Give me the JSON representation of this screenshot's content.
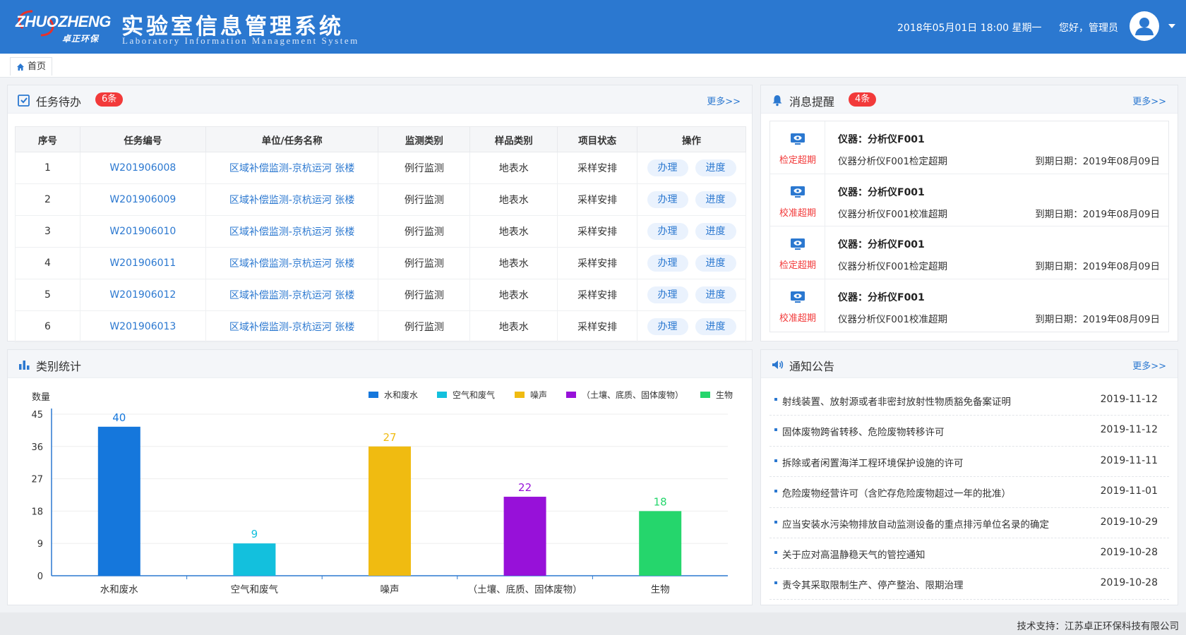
{
  "header": {
    "logo_text": "ZHUOZHENG",
    "logo_sub": "卓正环保",
    "title": "实验室信息管理系统",
    "subtitle": "Laboratory Information Management System",
    "datetime": "2018年05月01日  18:00  星期一",
    "greeting": "您好，管理员"
  },
  "tabs": [
    {
      "label": "首页",
      "icon": "home-icon"
    }
  ],
  "tasks": {
    "title": "任务待办",
    "badge": "6条",
    "more": "更多>>",
    "columns": [
      "序号",
      "任务编号",
      "单位/任务名称",
      "监测类别",
      "样品类别",
      "项目状态",
      "操作"
    ],
    "rows": [
      {
        "no": "1",
        "id": "W201906008",
        "name": "区域补偿监测-京杭运河 张楼",
        "monitor": "例行监测",
        "sample": "地表水",
        "status": "采样安排"
      },
      {
        "no": "2",
        "id": "W201906009",
        "name": "区域补偿监测-京杭运河 张楼",
        "monitor": "例行监测",
        "sample": "地表水",
        "status": "采样安排"
      },
      {
        "no": "3",
        "id": "W201906010",
        "name": "区域补偿监测-京杭运河 张楼",
        "monitor": "例行监测",
        "sample": "地表水",
        "status": "采样安排"
      },
      {
        "no": "4",
        "id": "W201906011",
        "name": "区域补偿监测-京杭运河 张楼",
        "monitor": "例行监测",
        "sample": "地表水",
        "status": "采样安排"
      },
      {
        "no": "5",
        "id": "W201906012",
        "name": "区域补偿监测-京杭运河 张楼",
        "monitor": "例行监测",
        "sample": "地表水",
        "status": "采样安排"
      },
      {
        "no": "6",
        "id": "W201906013",
        "name": "区域补偿监测-京杭运河 张楼",
        "monitor": "例行监测",
        "sample": "地表水",
        "status": "采样安排"
      }
    ],
    "handle_label": "办理",
    "progress_label": "进度"
  },
  "messages": {
    "title": "消息提醒",
    "badge": "4条",
    "more": "更多>>",
    "items": [
      {
        "tag": "检定超期",
        "title": "仪器：分析仪F001",
        "desc": "仪器分析仪F001检定超期",
        "due": "到期日期：2019年08月09日"
      },
      {
        "tag": "校准超期",
        "title": "仪器：分析仪F001",
        "desc": "仪器分析仪F001校准超期",
        "due": "到期日期：2019年08月09日"
      },
      {
        "tag": "检定超期",
        "title": "仪器：分析仪F001",
        "desc": "仪器分析仪F001检定超期",
        "due": "到期日期：2019年08月09日"
      },
      {
        "tag": "校准超期",
        "title": "仪器：分析仪F001",
        "desc": "仪器分析仪F001校准超期",
        "due": "到期日期：2019年08月09日"
      }
    ]
  },
  "stats": {
    "title": "类别统计"
  },
  "chart_data": {
    "type": "bar",
    "ylabel": "数量",
    "ylim": [
      0,
      45
    ],
    "yticks": [
      0,
      9,
      18,
      27,
      36,
      45
    ],
    "categories": [
      "水和废水",
      "空气和废气",
      "噪声",
      "（土壤、底质、固体废物）",
      "生物"
    ],
    "values": [
      40,
      9,
      27,
      22,
      18
    ],
    "bar_heights": [
      41.5,
      9,
      36,
      22,
      18
    ],
    "colors": [
      "#1577dc",
      "#13c0dd",
      "#f0bb11",
      "#9711d9",
      "#25d66c"
    ],
    "legend": [
      "水和废水",
      "空气和废气",
      "噪声",
      "（土壤、底质、固体废物）",
      "生物"
    ],
    "legend_position": "top-right",
    "grid": true
  },
  "notices": {
    "title": "通知公告",
    "more": "更多>>",
    "items": [
      {
        "text": "射线装置、放射源或者非密封放射性物质豁免备案证明",
        "date": "2019-11-12"
      },
      {
        "text": "固体废物跨省转移、危险废物转移许可",
        "date": "2019-11-12"
      },
      {
        "text": "拆除或者闲置海洋工程环境保护设施的许可",
        "date": "2019-11-11"
      },
      {
        "text": "危险废物经营许可（含贮存危险废物超过一年的批准）",
        "date": "2019-11-01"
      },
      {
        "text": "应当安装水污染物排放自动监测设备的重点排污单位名录的确定",
        "date": "2019-10-29"
      },
      {
        "text": "关于应对高温静稳天气的管控通知",
        "date": "2019-10-28"
      },
      {
        "text": "责令其采取限制生产、停产整治、限期治理",
        "date": "2019-10-28"
      }
    ]
  },
  "footer": {
    "text": "技术支持：江苏卓正环保科技有限公司"
  }
}
